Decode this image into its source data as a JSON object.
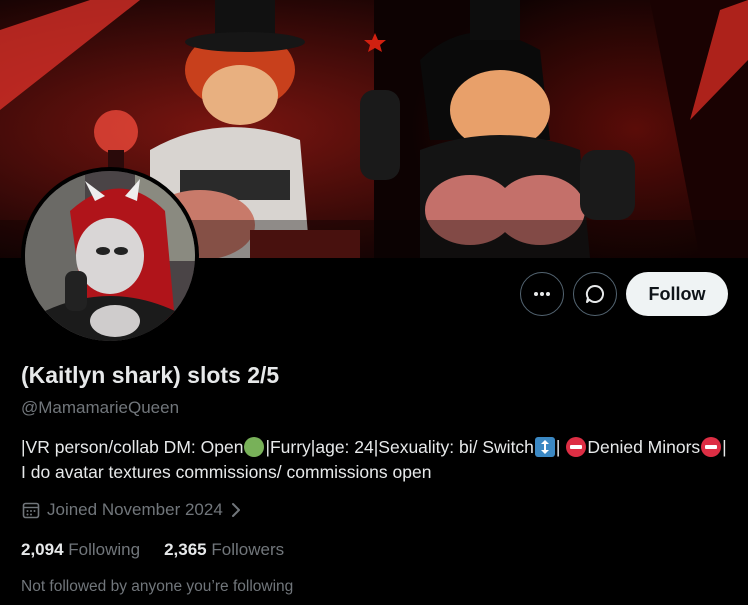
{
  "profile": {
    "display_name": "(Kaitlyn shark) slots 2/5",
    "handle": "@MamamarieQueen",
    "bio": {
      "part1": "|VR person/collab DM: Open",
      "part2": "|Furry|age: 24|Sexuality: bi/ Switch",
      "part3": "| ",
      "part4": "Denied Minors",
      "part5": "| I do avatar textures commissions/ commissions open"
    },
    "joined": "Joined November 2024",
    "following_count": "2,094",
    "following_label": "Following",
    "followers_count": "2,365",
    "followers_label": "Followers",
    "not_followed_text": "Not followed by anyone you’re following"
  },
  "actions": {
    "more_icon": "more-horizontal-icon",
    "message_icon": "message-bubble-icon",
    "follow_label": "Follow"
  },
  "colors": {
    "background": "#000000",
    "primary_text": "#e7e9ea",
    "secondary_text": "#71767b",
    "button_border": "#536471",
    "follow_bg": "#eff3f4",
    "banner_accent": "#e0312a"
  }
}
